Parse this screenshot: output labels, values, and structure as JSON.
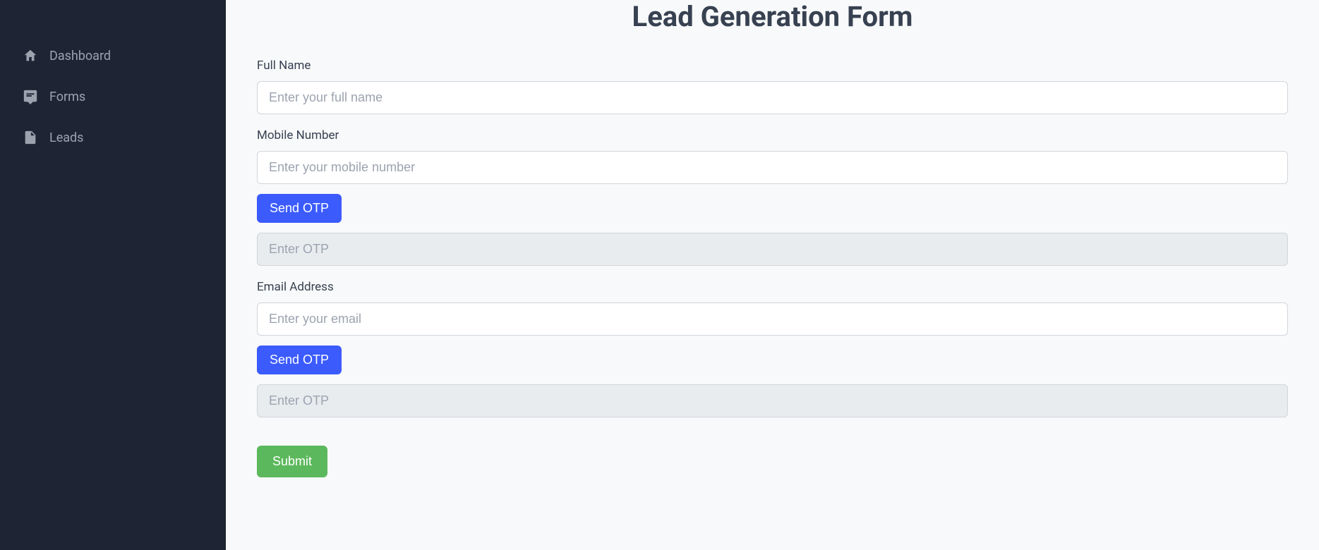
{
  "sidebar": {
    "items": [
      {
        "label": "Dashboard"
      },
      {
        "label": "Forms"
      },
      {
        "label": "Leads"
      }
    ]
  },
  "form": {
    "title": "Lead Generation Form",
    "full_name_label": "Full Name",
    "full_name_placeholder": "Enter your full name",
    "mobile_label": "Mobile Number",
    "mobile_placeholder": "Enter your mobile number",
    "send_otp_mobile": "Send OTP",
    "otp_mobile_placeholder": "Enter OTP",
    "email_label": "Email Address",
    "email_placeholder": "Enter your email",
    "send_otp_email": "Send OTP",
    "otp_email_placeholder": "Enter OTP",
    "submit_label": "Submit"
  }
}
